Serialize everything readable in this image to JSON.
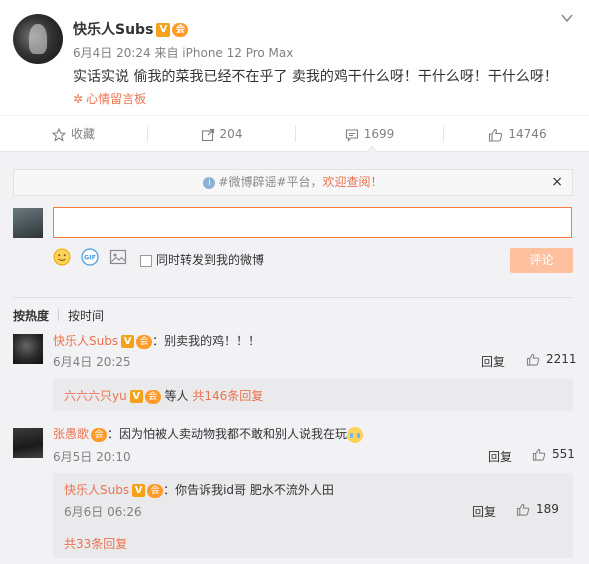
{
  "post": {
    "author": "快乐人Subs",
    "vip_badge": "V",
    "member_badge": "会",
    "meta": "6月4日 20:24 来自 iPhone 12 Pro Max",
    "text": "实话实说 偷我的菜我已经不在乎了 卖我的鸡干什么呀！干什么呀！干什么呀！",
    "mood_label": "心情留言板"
  },
  "actions": {
    "favorite_label": "收藏",
    "repost_count": "204",
    "comment_count": "1699",
    "like_count": "14746"
  },
  "notice": {
    "prefix": "#微博辟谣#平台，",
    "highlight": "欢迎查阅！",
    "close": "×"
  },
  "composer": {
    "input_value": "",
    "repost_label": "同时转发到我的微博",
    "submit_label": "评论"
  },
  "sort": {
    "active": "按热度",
    "other": "按时间"
  },
  "comments": [
    {
      "name": "快乐人Subs",
      "text": "：别卖我的鸡！！！",
      "time": "6月4日 20:25",
      "reply_label": "回复",
      "likes": "2211",
      "sub": {
        "name": "六六六只yu",
        "text": "等人",
        "more": "共146条回复"
      }
    },
    {
      "name": "张愚歌",
      "text": "：因为怕被人卖动物我都不敢和别人说我在玩",
      "time": "6月5日 20:10",
      "reply_label": "回复",
      "likes": "551",
      "sub": {
        "name": "快乐人Subs",
        "text": "：你告诉我id哥 肥水不流外人田",
        "time": "6月6日 06:26",
        "reply_label": "回复",
        "likes": "189",
        "more": "共33条回复"
      }
    }
  ],
  "colors": {
    "accent": "#eb7350",
    "vip": "#f3a21a",
    "input_border": "#fa7d3c",
    "submit_disabled": "#ffc09f"
  }
}
